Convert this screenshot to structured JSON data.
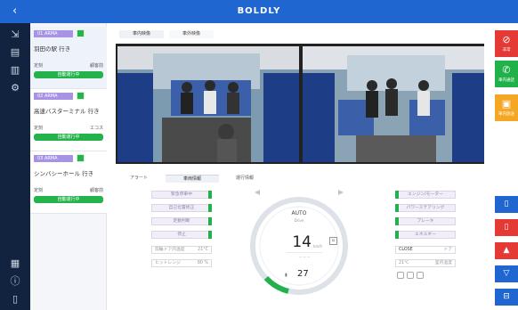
{
  "app": {
    "title": "BOLDLY",
    "back_icon": "‹"
  },
  "leftnav": {
    "icons": [
      "sign-in-icon",
      "monitor-icon",
      "chart-icon",
      "gear-icon",
      "clipboard-icon",
      "info-icon",
      "document-icon"
    ]
  },
  "vehicles": [
    {
      "tag": "01 ARMA",
      "dest": "羽田の駅 行き",
      "row_left": "定刻",
      "row_right": "顧客前",
      "status": "自動運行中"
    },
    {
      "tag": "02 ARMA",
      "dest": "高速バスターミナル 行き",
      "row_left": "定刻",
      "row_right": "エコス",
      "status": "自動運行中"
    },
    {
      "tag": "03 ARMA",
      "dest": "シンバシーホール 行き",
      "row_left": "定刻",
      "row_right": "顧客前",
      "status": "自動運行中"
    }
  ],
  "camera_tabs": [
    "車内映像",
    "車外映像"
  ],
  "panel_tabs": [
    "アラート",
    "車両情報",
    "運行情報"
  ],
  "left_buttons": [
    "緊急停車中",
    "自己位置修正",
    "走動判断",
    "停止"
  ],
  "left_fields": [
    {
      "label": "前輪ドア内温度",
      "value": "21°C"
    },
    {
      "label": "ヒットレンジ",
      "value": "80 %"
    }
  ],
  "gauge": {
    "mode": "AUTO",
    "mode_sub": "Drive",
    "speed": "14",
    "unit": "km/h",
    "temp": "27"
  },
  "right_buttons": [
    "エンジン/モーター",
    "パワーステアリング",
    "ブレーキ",
    "エネルギー"
  ],
  "right_fields": [
    {
      "label": "CLOSE",
      "value": "ドア"
    },
    {
      "label": "21℃",
      "value": "室内温度"
    }
  ],
  "action_buttons": [
    {
      "label": "非常",
      "color": "#e53935",
      "icon": "⊘"
    },
    {
      "label": "車内通話",
      "color": "#21b14a",
      "icon": "✆"
    },
    {
      "label": "車内放送",
      "color": "#f5a623",
      "icon": "▣"
    }
  ],
  "side_buttons": [
    {
      "icon": "▯",
      "color": "#1f66d0"
    },
    {
      "icon": "▯",
      "color": "#e53935"
    },
    {
      "icon": "▲",
      "color": "#e53935"
    },
    {
      "icon": "▽",
      "color": "#1f66d0"
    },
    {
      "icon": "⊟",
      "color": "#1f66d0"
    }
  ]
}
